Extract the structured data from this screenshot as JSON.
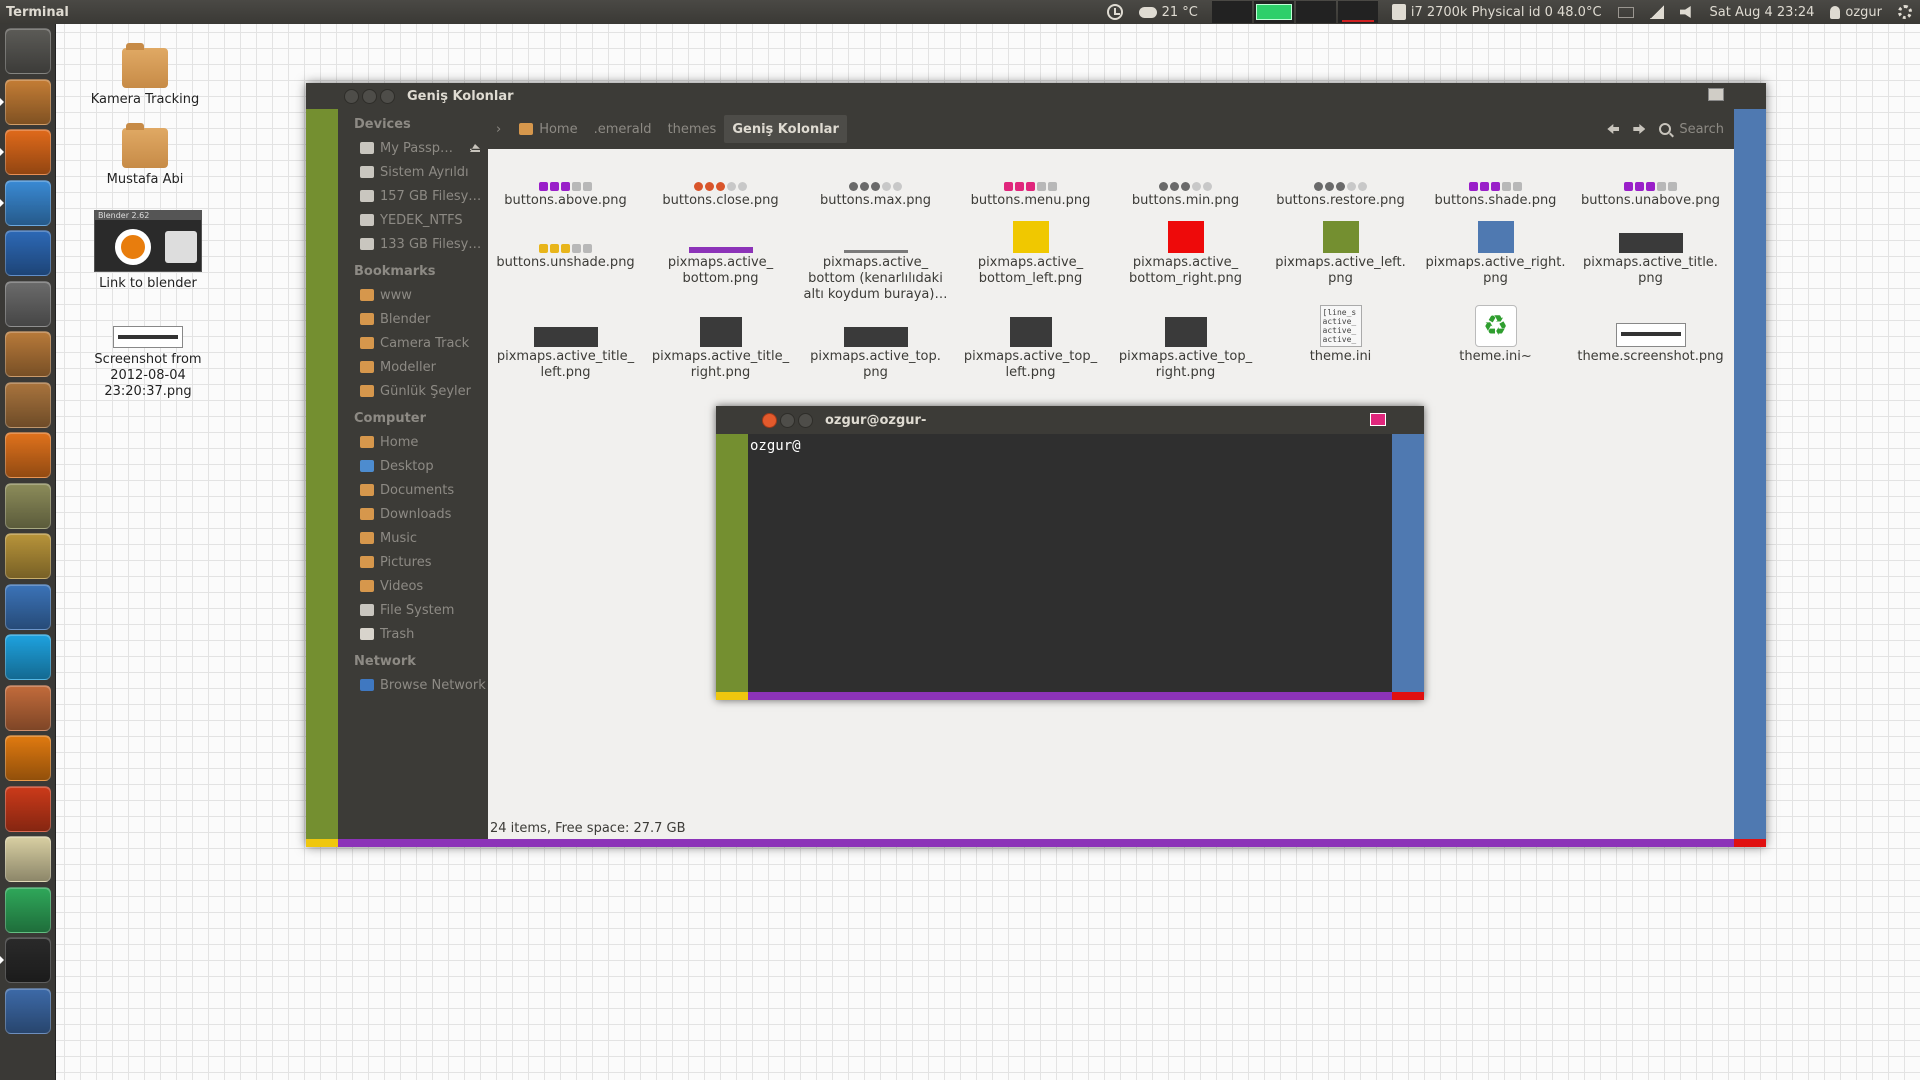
{
  "panel": {
    "app_title": "Terminal",
    "weather": "21 °C",
    "temperature": "i7 2700k Physical id 0 48.0°C",
    "datetime": "Sat Aug  4 23:24",
    "username": "ozgur",
    "icons": [
      "clock-icon",
      "weather-icon",
      "cpu-temp-icon",
      "mail-icon",
      "network-icon",
      "volume-icon",
      "user-icon",
      "gear-icon"
    ]
  },
  "launcher": {
    "items": [
      {
        "name": "dash-home",
        "color": "#5c5b57"
      },
      {
        "name": "files",
        "color": "#c47d35"
      },
      {
        "name": "firefox",
        "color": "#e06a1b"
      },
      {
        "name": "chrome",
        "color": "#3a8ad4"
      },
      {
        "name": "libreoffice-writer",
        "color": "#2d69b6"
      },
      {
        "name": "rhythmbox",
        "color": "#6b6b6b"
      },
      {
        "name": "software-center",
        "color": "#b87a3a"
      },
      {
        "name": "package-installer",
        "color": "#a9743d"
      },
      {
        "name": "blender",
        "color": "#e0721c"
      },
      {
        "name": "gimp",
        "color": "#8c8c5a"
      },
      {
        "name": "inkscape-notes",
        "color": "#b8943a"
      },
      {
        "name": "mypaint",
        "color": "#3b73b8"
      },
      {
        "name": "skype",
        "color": "#1ea2df"
      },
      {
        "name": "eye-viewer",
        "color": "#c26b3b"
      },
      {
        "name": "vlc",
        "color": "#e07a10"
      },
      {
        "name": "download-manager",
        "color": "#cc3a1a"
      },
      {
        "name": "text-editor",
        "color": "#d8cfa2"
      },
      {
        "name": "emerald-theme",
        "color": "#2fa85a"
      },
      {
        "name": "terminal",
        "color": "#2a2a2a"
      },
      {
        "name": "workspace-switcher",
        "color": "#3d6aa8"
      }
    ]
  },
  "desktop": {
    "icons": [
      {
        "label": "Kamera Tracking"
      },
      {
        "label": "Mustafa Abi"
      },
      {
        "label": "Link to blender",
        "thumb_text": "Blender 2.62"
      },
      {
        "label": "Screenshot from 2012-08-04 23:20:37.png"
      }
    ]
  },
  "file_manager": {
    "title": "Geniş Kolonlar",
    "sidebar": {
      "devices_heading": "Devices",
      "devices": [
        "My Passp…",
        "Sistem Ayrıldı",
        "157 GB Filesy…",
        "YEDEK_NTFS",
        "133 GB Filesy…"
      ],
      "bookmarks_heading": "Bookmarks",
      "bookmarks": [
        "www",
        "Blender",
        "Camera Track",
        "Modeller",
        "Günlük Şeyler"
      ],
      "computer_heading": "Computer",
      "computer": [
        "Home",
        "Desktop",
        "Documents",
        "Downloads",
        "Music",
        "Pictures",
        "Videos",
        "File System",
        "Trash"
      ],
      "network_heading": "Network",
      "network": [
        "Browse Network"
      ]
    },
    "breadcrumbs": [
      "Home",
      ".emerald",
      "themes",
      "Geniş Kolonlar"
    ],
    "search_label": "Search",
    "files": [
      {
        "name": "buttons.above.png",
        "thumb": "btns",
        "colors": [
          "#9a1fc9",
          "#9a1fc9",
          "#9a1fc9",
          "#b8b8b8",
          "#b8b8b8"
        ]
      },
      {
        "name": "buttons.close.png",
        "thumb": "circles",
        "colors": [
          "#d9552b",
          "#d9552b",
          "#d9552b",
          "#c8c8c8",
          "#c8c8c8"
        ]
      },
      {
        "name": "buttons.max.png",
        "thumb": "circles",
        "colors": [
          "#6a6a6a",
          "#6a6a6a",
          "#6a6a6a",
          "#c8c8c8",
          "#c8c8c8"
        ]
      },
      {
        "name": "buttons.menu.png",
        "thumb": "btns",
        "colors": [
          "#e0267c",
          "#e0267c",
          "#e0267c",
          "#b8b8b8",
          "#b8b8b8"
        ]
      },
      {
        "name": "buttons.min.png",
        "thumb": "circles",
        "colors": [
          "#6a6a6a",
          "#6a6a6a",
          "#6a6a6a",
          "#c8c8c8",
          "#c8c8c8"
        ]
      },
      {
        "name": "buttons.restore.png",
        "thumb": "circles",
        "colors": [
          "#6a6a6a",
          "#6a6a6a",
          "#6a6a6a",
          "#c8c8c8",
          "#c8c8c8"
        ]
      },
      {
        "name": "buttons.shade.png",
        "thumb": "btns",
        "colors": [
          "#9a1fc9",
          "#9a1fc9",
          "#9a1fc9",
          "#b8b8b8",
          "#b8b8b8"
        ]
      },
      {
        "name": "buttons.unabove.png",
        "thumb": "btns",
        "colors": [
          "#9a1fc9",
          "#9a1fc9",
          "#9a1fc9",
          "#b8b8b8",
          "#b8b8b8"
        ]
      },
      {
        "name": "buttons.unshade.png",
        "thumb": "btns",
        "colors": [
          "#e8b51a",
          "#e8b51a",
          "#e8b51a",
          "#b8b8b8",
          "#b8b8b8"
        ]
      },
      {
        "name": "pixmaps.active_\nbottom.png",
        "thumb": "bar",
        "color": "#8c33b8"
      },
      {
        "name": "pixmaps.active_\nbottom (kenarlılıdaki\naltı koydum buraya)…",
        "thumb": "line",
        "color": "#7a7a7a"
      },
      {
        "name": "pixmaps.active_\nbottom_left.png",
        "thumb": "sq",
        "color": "#f0c800"
      },
      {
        "name": "pixmaps.active_\nbottom_right.png",
        "thumb": "sq",
        "color": "#ee0a0a"
      },
      {
        "name": "pixmaps.active_left.\npng",
        "thumb": "sq",
        "color": "#748f30"
      },
      {
        "name": "pixmaps.active_right.\npng",
        "thumb": "sq",
        "color": "#4f79b1"
      },
      {
        "name": "pixmaps.active_title.\npng",
        "thumb": "darkwide",
        "color": "#3a3a3a"
      },
      {
        "name": "pixmaps.active_title_\nleft.png",
        "thumb": "darkwide",
        "color": "#3a3a3a"
      },
      {
        "name": "pixmaps.active_title_\nright.png",
        "thumb": "darksq",
        "color": "#3a3a3a"
      },
      {
        "name": "pixmaps.active_top.\npng",
        "thumb": "darkwide",
        "color": "#3a3a3a"
      },
      {
        "name": "pixmaps.active_top_\nleft.png",
        "thumb": "darksq",
        "color": "#3a3a3a"
      },
      {
        "name": "pixmaps.active_top_\nright.png",
        "thumb": "darksq",
        "color": "#3a3a3a"
      },
      {
        "name": "theme.ini",
        "thumb": "ini",
        "ini_text": "[line_s\nactive_\nactive_\nactive_"
      },
      {
        "name": "theme.ini~",
        "thumb": "recycle"
      },
      {
        "name": "theme.screenshot.png",
        "thumb": "shot"
      }
    ],
    "status": "24 items, Free space: 27.7 GB"
  },
  "terminal": {
    "title": "ozgur@ozgur-",
    "prompt": "ozgur@"
  },
  "colors": {
    "frame_left": "#748f30",
    "frame_right": "#4f79b1",
    "frame_bottom": "#8c33b8",
    "corner_bottom_left": "#efc70e",
    "corner_bottom_right": "#e01010"
  }
}
